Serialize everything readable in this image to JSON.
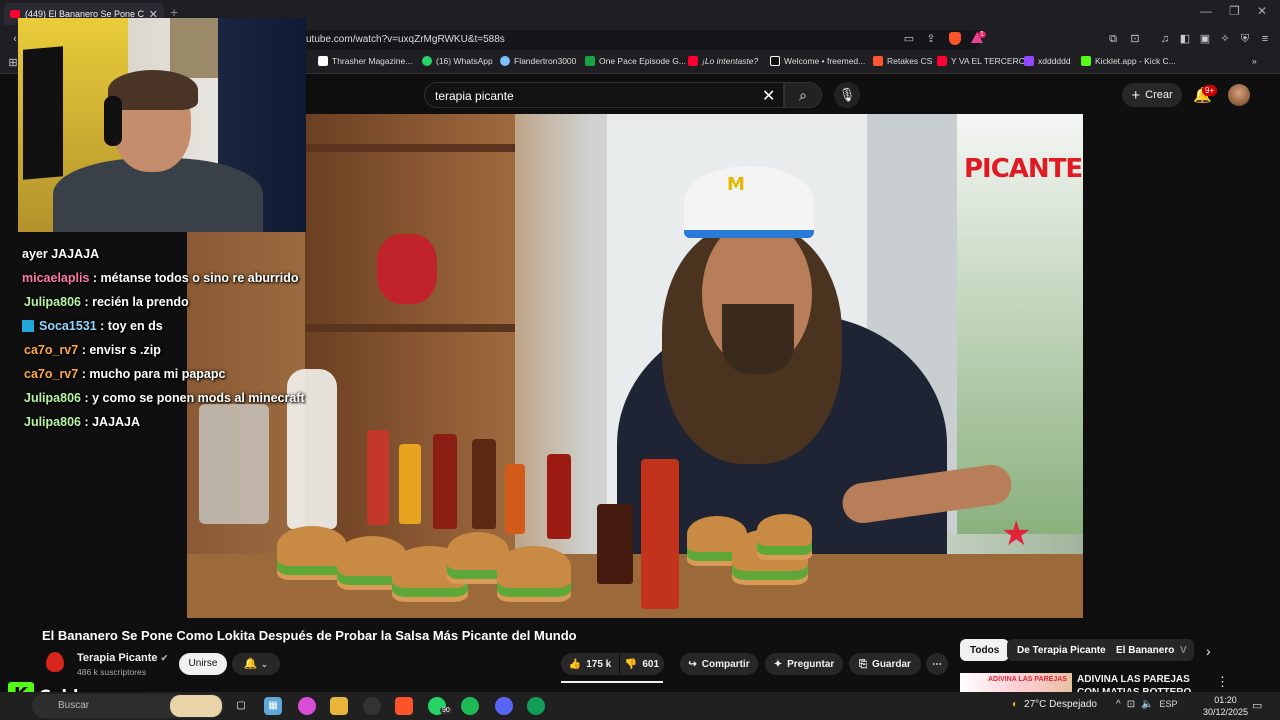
{
  "browser": {
    "tab_title": "(449) El Bananero Se Pone Com",
    "url": "utube.com/watch?v=uxqZrMgRWKU&t=588s",
    "extension_badge": "1",
    "bookmarks": [
      {
        "label": "Thrasher Magazine...",
        "color": "#ffffff"
      },
      {
        "label": "(16) WhatsApp",
        "color": "#25d366"
      },
      {
        "label": "Flandertron3000",
        "color": "#7ac0ff"
      },
      {
        "label": "One Pace Episode G...",
        "color": "#19a347"
      },
      {
        "label": "¡Lo intentaste?",
        "color": "#ff0033"
      },
      {
        "label": "Welcome • freemed...",
        "color": "#ffffff"
      },
      {
        "label": "Retakes CS",
        "color": "#ff5533"
      },
      {
        "label": "Y VA EL TERCERO",
        "color": "#ff0033"
      },
      {
        "label": "xdddddd",
        "color": "#9146ff"
      },
      {
        "label": "Kicklet.app - Kick C...",
        "color": "#53fc18"
      }
    ]
  },
  "youtube": {
    "search_query": "terapia picante",
    "create_label": "Crear",
    "notif_badge": "9+",
    "video_overlay_text": "PICANTE",
    "video_title": "El Bananero Se Pone Como Lokita Después de Probar la Salsa Más Picante del Mundo",
    "channel_name": "Terapia Picante",
    "subscribers": "486 k suscriptores",
    "join_label": "Unirse",
    "likes": "175 k",
    "dislikes": "601",
    "share_label": "Compartir",
    "ask_label": "Preguntar",
    "save_label": "Guardar",
    "chips": [
      "Todos",
      "De Terapia Picante",
      "El Bananero",
      "V"
    ],
    "rec_title": "ADIVINA LAS PAREJAS CON MATIAS BOTTERO",
    "rec_thumb_text": "ADIVINA LAS PAREJAS"
  },
  "stream_chat": [
    {
      "user": "",
      "msg": "ayer JAJAJA",
      "color": "#ffffff",
      "badge": false
    },
    {
      "user": "micaelaplis",
      "msg": " : métanse todos o sino re aburrido",
      "color": "#ff7aa8",
      "badge": false
    },
    {
      "user": "Julipa806",
      "msg": " : recién la prendo",
      "color": "#b6f5a0",
      "badge": false
    },
    {
      "user": "Soca1531",
      "msg": " : toy en ds",
      "color": "#8fd7ff",
      "badge": true
    },
    {
      "user": "ca7o_rv7",
      "msg": " : envisr s .zip",
      "color": "#ffa84a",
      "badge": false
    },
    {
      "user": "ca7o_rv7",
      "msg": " : mucho para mi papapc",
      "color": "#ffa84a",
      "badge": false
    },
    {
      "user": "Julipa806",
      "msg": " : y como se ponen mods al minecraft",
      "color": "#b6f5a0",
      "badge": false
    },
    {
      "user": "Julipa806",
      "msg": " : JAJAJA",
      "color": "#b6f5a0",
      "badge": false
    }
  ],
  "stream": {
    "kick_logo": "K",
    "streamer_name": "Caldeerass"
  },
  "taskbar": {
    "search_placeholder": "Buscar",
    "whatsapp_badge": "90",
    "weather": "27°C  Despejado",
    "lang": "ESP",
    "time": "01:20",
    "date": "30/12/2025"
  }
}
